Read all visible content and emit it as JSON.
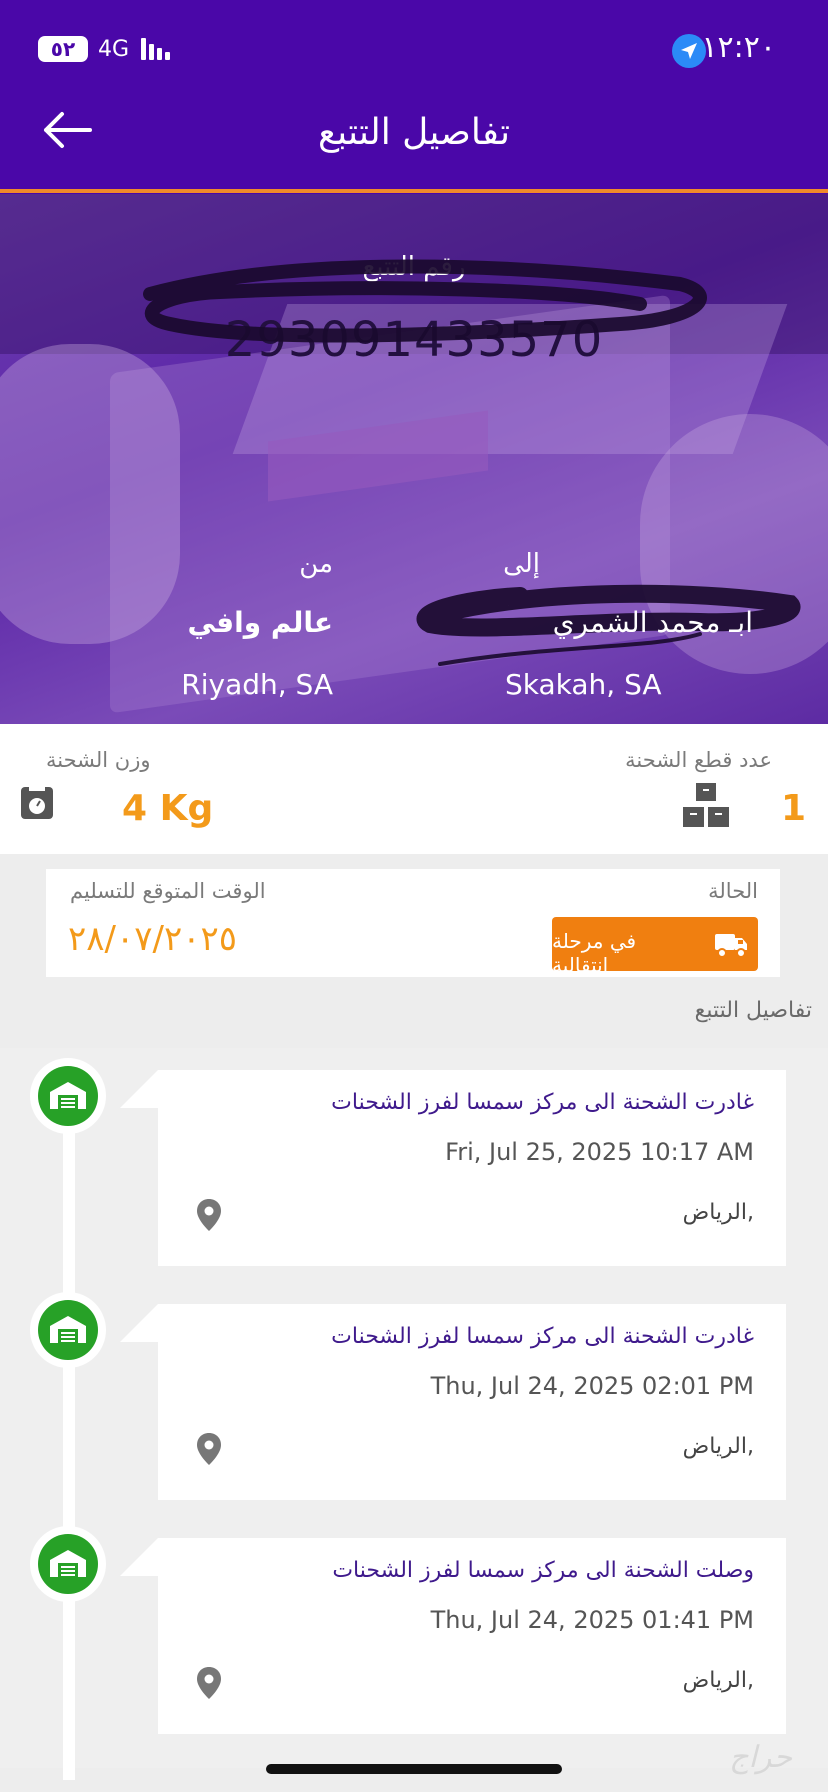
{
  "status_bar": {
    "time": "١٢:٢٠",
    "battery": "٥٢",
    "network": "4G"
  },
  "header": {
    "title": "تفاصيل التتبع"
  },
  "hero": {
    "tracking_label": "رقم التتبع",
    "tracking_number": "293091433570",
    "from_label": "من",
    "to_label": "إلى",
    "from_name": "عالم وافي",
    "to_name": "ابـ محمد الشمري",
    "from_city": "Riyadh, SA",
    "to_city": "Skakah, SA"
  },
  "stats": {
    "weight_label": "وزن الشحنة",
    "weight_value": "4 Kg",
    "pieces_label": "عدد قطع الشحنة",
    "pieces_value": "1"
  },
  "status": {
    "eta_label": "الوقت المتوقع للتسليم",
    "eta_value": "٢٨/٠٧/٢٠٢٥",
    "state_label": "الحالة",
    "state_value": "في مرحلة انتقالية"
  },
  "timeline": {
    "section_title": "تفاصيل التتبع",
    "events": [
      {
        "title": "غادرت الشحنة الى مركز سمسا لفرز الشحنات",
        "date": "Fri, Jul 25, 2025 10:17 AM",
        "location": "الرياض,"
      },
      {
        "title": "غادرت الشحنة الى مركز سمسا لفرز الشحنات",
        "date": "Thu, Jul 24, 2025 02:01 PM",
        "location": "الرياض,"
      },
      {
        "title": "وصلت الشحنة الى مركز سمسا لفرز الشحنات",
        "date": "Thu, Jul 24, 2025 01:41 PM",
        "location": "الرياض,"
      }
    ]
  },
  "watermark": "حراج",
  "colors": {
    "header": "#4a07a8",
    "accent_orange": "#f39a1a",
    "badge_orange": "#f07f10",
    "event_green": "#27a127",
    "event_title": "#3f1a8c"
  }
}
